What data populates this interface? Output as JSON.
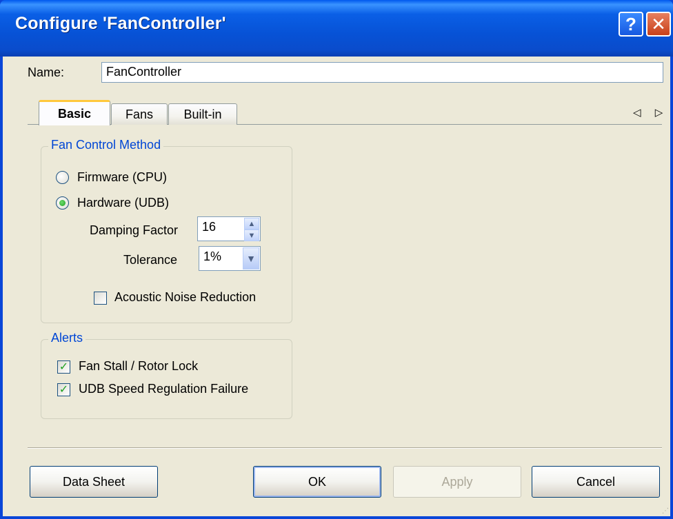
{
  "window": {
    "title": "Configure 'FanController'",
    "help_label": "?",
    "close_label": "✕"
  },
  "name_field": {
    "label": "Name:",
    "value": "FanController"
  },
  "tabs": [
    {
      "label": "Basic"
    },
    {
      "label": "Fans"
    },
    {
      "label": "Built-in"
    }
  ],
  "tab_arrows": "◁ ▷",
  "fan_control": {
    "title": "Fan Control Method",
    "firmware_label": "Firmware (CPU)",
    "hardware_label": "Hardware (UDB)",
    "damping_label": "Damping Factor",
    "damping_value": "16",
    "tolerance_label": "Tolerance",
    "tolerance_value": "1%",
    "acoustic_label": "Acoustic Noise Reduction"
  },
  "alerts": {
    "title": "Alerts",
    "stall_label": "Fan Stall / Rotor Lock",
    "udb_label": "UDB Speed Regulation Failure"
  },
  "buttons": {
    "datasheet": "Data Sheet",
    "ok": "OK",
    "apply": "Apply",
    "cancel": "Cancel"
  },
  "glyphs": {
    "check": "✓",
    "spin_up": "▲",
    "spin_down": "▼",
    "dropdown": "▼",
    "grip": "⋰"
  }
}
